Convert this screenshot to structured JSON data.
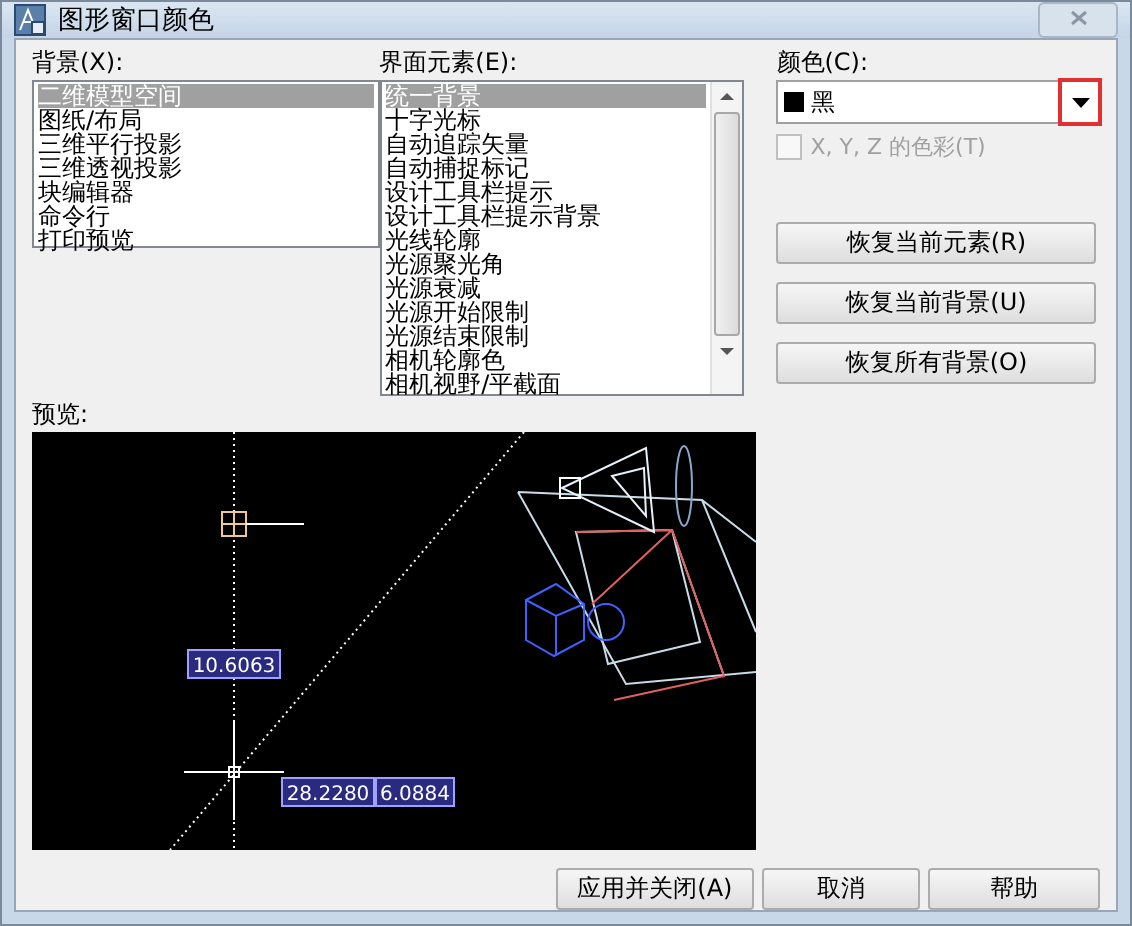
{
  "window": {
    "title": "图形窗口颜色"
  },
  "background_list": {
    "label": "背景(X):",
    "items": [
      {
        "text": "二维模型空间",
        "selected": true
      },
      {
        "text": "图纸/布局",
        "selected": false
      },
      {
        "text": "三维平行投影",
        "selected": false
      },
      {
        "text": "三维透视投影",
        "selected": false
      },
      {
        "text": "块编辑器",
        "selected": false
      },
      {
        "text": "命令行",
        "selected": false
      },
      {
        "text": "打印预览",
        "selected": false
      }
    ]
  },
  "interface_elements": {
    "label": "界面元素(E):",
    "items": [
      {
        "text": "统一背景",
        "selected": true
      },
      {
        "text": "十字光标",
        "selected": false
      },
      {
        "text": "自动追踪矢量",
        "selected": false
      },
      {
        "text": "自动捕捉标记",
        "selected": false
      },
      {
        "text": "设计工具栏提示",
        "selected": false
      },
      {
        "text": "设计工具栏提示背景",
        "selected": false
      },
      {
        "text": "光线轮廓",
        "selected": false
      },
      {
        "text": "光源聚光角",
        "selected": false
      },
      {
        "text": "光源衰减",
        "selected": false
      },
      {
        "text": "光源开始限制",
        "selected": false
      },
      {
        "text": "光源结束限制",
        "selected": false
      },
      {
        "text": "相机轮廓色",
        "selected": false
      },
      {
        "text": "相机视野/平截面",
        "selected": false
      }
    ]
  },
  "color": {
    "label": "颜色(C):",
    "value": "黑",
    "dropdown_highlighted": true
  },
  "tint_checkbox": {
    "label": "X, Y, Z 的色彩(T)",
    "checked": false,
    "disabled": true
  },
  "restore_buttons": [
    "恢复当前元素(R)",
    "恢复当前背景(U)",
    "恢复所有背景(O)"
  ],
  "preview": {
    "label": "预览:",
    "measurements": [
      "10.6063",
      "28.2280",
      "6.0884"
    ]
  },
  "buttons": [
    "应用并关闭(A)",
    "取消",
    "帮助"
  ]
}
